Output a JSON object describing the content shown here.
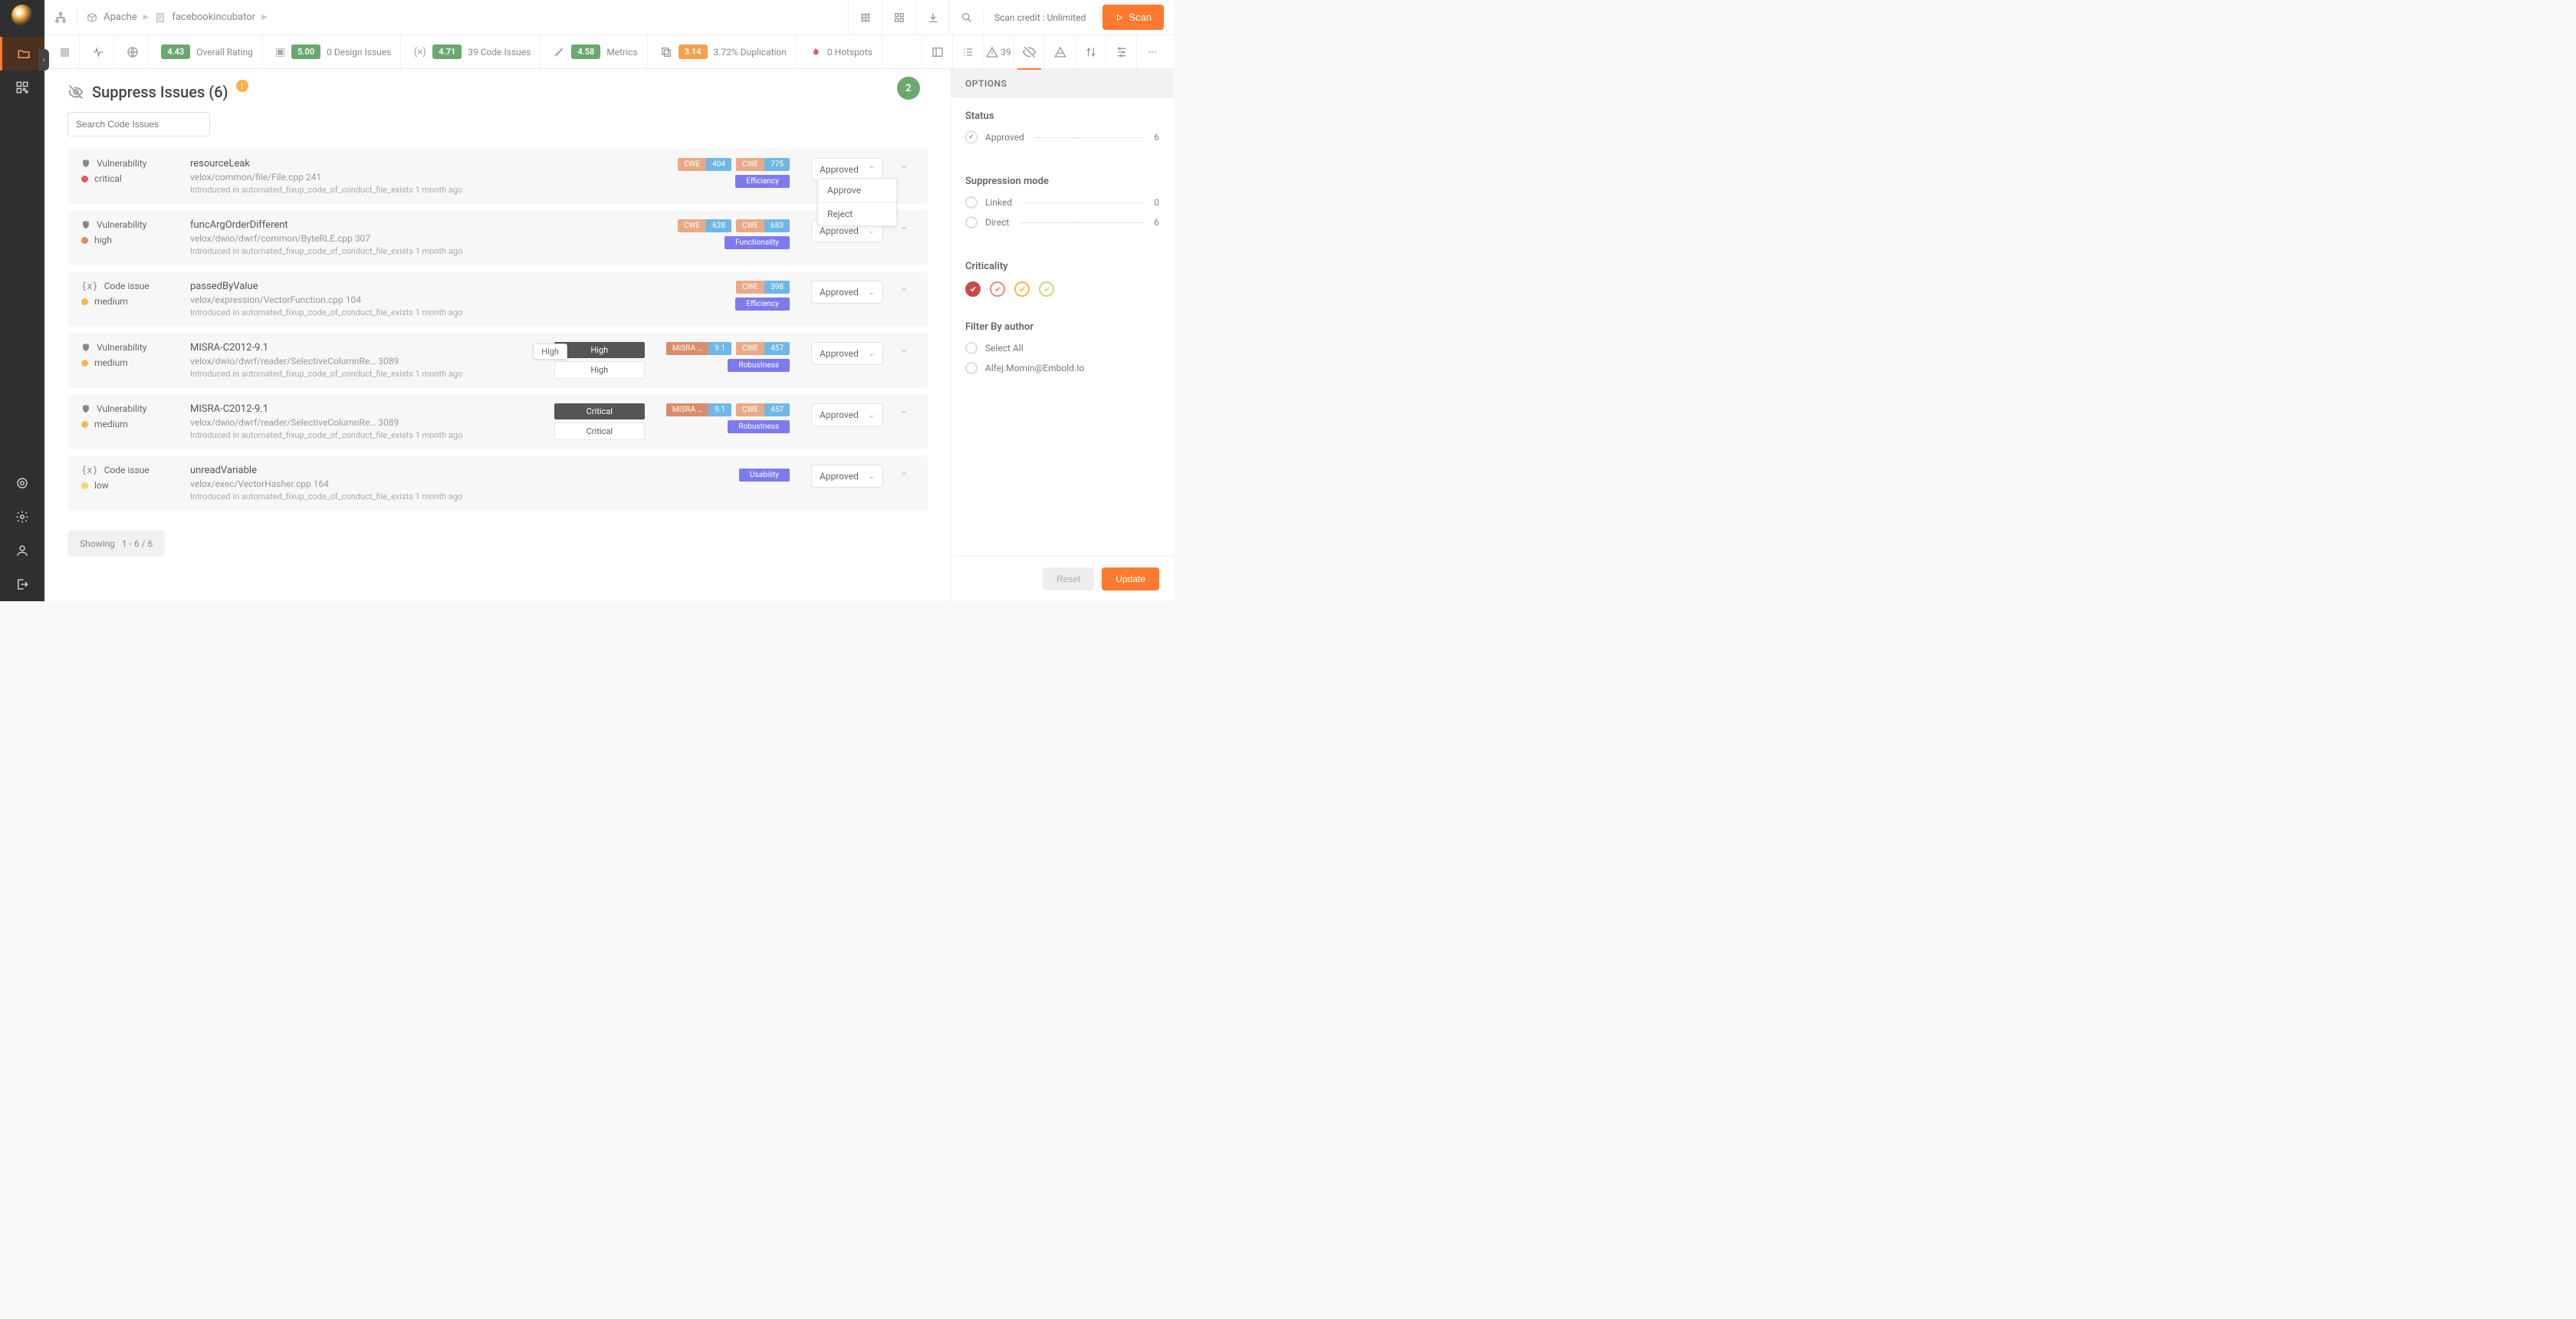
{
  "breadcrumb": {
    "org": "Apache",
    "repo": "facebookincubator"
  },
  "header": {
    "credit": "Scan credit : Unlimited",
    "scan_btn": "Scan"
  },
  "metrics": {
    "overall": {
      "score": "4.43",
      "label": "Overall Rating"
    },
    "design": {
      "score": "5.00",
      "label": "0 Design Issues"
    },
    "code": {
      "score": "4.71",
      "label": "39 Code Issues"
    },
    "metrics": {
      "score": "4.58",
      "label": "Metrics"
    },
    "dup": {
      "score": "3.14",
      "label": "3.72% Duplication"
    },
    "hotspots": {
      "label": "0 Hotspots"
    },
    "alerts_count": "39"
  },
  "page": {
    "title": "Suppress Issues (6)",
    "search_ph": "Search Code Issues",
    "badge": "2",
    "paging_label": "Showing",
    "paging_range": "1 - 6 / 6"
  },
  "dropdown": {
    "approve": "Approve",
    "reject": "Reject"
  },
  "issues": [
    {
      "kind": "Vulnerability",
      "kind_icon": "shield",
      "severity": "critical",
      "name": "resourceLeak",
      "path": "velox/common/file/File.cpp  241",
      "intro": "Introduced in automated_fixup_code_of_conduct_file_exists 1 month ago",
      "tags": [
        {
          "l": "CWE",
          "r": "404"
        },
        {
          "l": "CWE",
          "r": "775"
        }
      ],
      "func": "Efficiency",
      "status": "Approved",
      "open": true
    },
    {
      "kind": "Vulnerability",
      "kind_icon": "shield",
      "severity": "high",
      "name": "funcArgOrderDifferent",
      "path": "velox/dwio/dwrf/common/ByteRLE.cpp  307",
      "intro": "Introduced in automated_fixup_code_of_conduct_file_exists 1 month ago",
      "tags": [
        {
          "l": "CWE",
          "r": "628"
        },
        {
          "l": "CWE",
          "r": "683"
        }
      ],
      "func": "Functionality",
      "status": "Approved"
    },
    {
      "kind": "Code issue",
      "kind_icon": "brackets",
      "severity": "medium",
      "name": "passedByValue",
      "path": "velox/expression/VectorFunction.cpp  104",
      "intro": "Introduced in automated_fixup_code_of_conduct_file_exists 1 month ago",
      "tags": [
        {
          "l": "CWE",
          "r": "398"
        }
      ],
      "func": "Efficiency",
      "status": "Approved"
    },
    {
      "kind": "Vulnerability",
      "kind_icon": "shield",
      "severity": "medium",
      "name": "MISRA-C2012-9.1",
      "path": "velox/dwio/dwrf/reader/SelectiveColumnRe…   3089",
      "intro": "Introduced in automated_fixup_code_of_conduct_file_exists 1 month ago",
      "sevpills": [
        "High",
        "High"
      ],
      "tooltip": "High",
      "tags": [
        {
          "l": "MISRA …",
          "r": "9.1",
          "misra": true
        },
        {
          "l": "CWE",
          "r": "457"
        }
      ],
      "func": "Robustness",
      "status": "Approved"
    },
    {
      "kind": "Vulnerability",
      "kind_icon": "shield",
      "severity": "medium",
      "name": "MISRA-C2012-9.1",
      "path": "velox/dwio/dwrf/reader/SelectiveColumnRe…   3089",
      "intro": "Introduced in automated_fixup_code_of_conduct_file_exists 1 month ago",
      "sevpills": [
        "Critical",
        "Critical"
      ],
      "tags": [
        {
          "l": "MISRA …",
          "r": "9.1",
          "misra": true
        },
        {
          "l": "CWE",
          "r": "457"
        }
      ],
      "func": "Robustness",
      "status": "Approved"
    },
    {
      "kind": "Code issue",
      "kind_icon": "brackets",
      "severity": "low",
      "name": "unreadVariable",
      "path": "velox/exec/VectorHasher.cpp  164",
      "intro": "Introduced in automated_fixup_code_of_conduct_file_exists 1 month ago",
      "tags": [],
      "func": "Usability",
      "status": "Approved"
    }
  ],
  "options": {
    "title": "OPTIONS",
    "status": {
      "label": "Status",
      "approved_label": "Approved",
      "approved_count": "6"
    },
    "suppression": {
      "label": "Suppression mode",
      "linked_label": "Linked",
      "linked_count": "0",
      "direct_label": "Direct",
      "direct_count": "6"
    },
    "criticality": {
      "label": "Criticality"
    },
    "author": {
      "label": "Filter By author",
      "select_all": "Select All",
      "items": [
        "Alfej.Momin@Embold.Io"
      ]
    },
    "reset": "Reset",
    "update": "Update"
  }
}
